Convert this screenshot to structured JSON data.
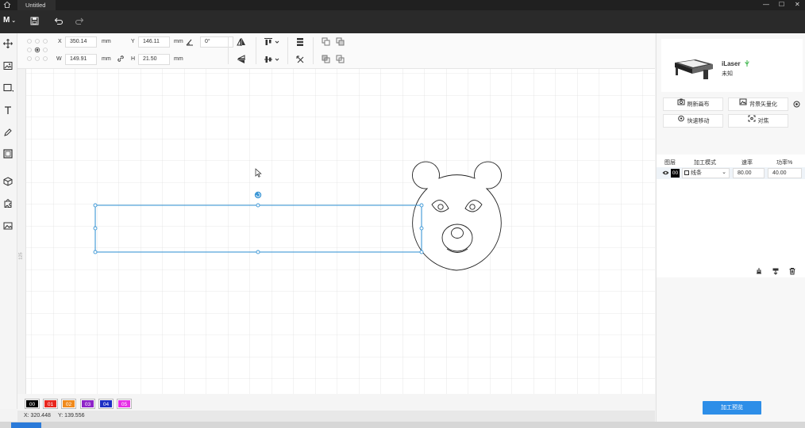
{
  "window": {
    "title": "Untitled",
    "controls": [
      "—",
      "☐",
      "✕"
    ]
  },
  "toolbar": {
    "logo": "M",
    "icons": [
      "save-icon",
      "undo-icon",
      "redo-icon"
    ]
  },
  "tools": [
    "move-icon",
    "image-icon",
    "rectangle-icon",
    "text-icon",
    "pen-icon",
    "frame-icon",
    "cube-icon",
    "puzzle-icon",
    "picture-icon"
  ],
  "props": {
    "x_label": "X",
    "x_value": "350.14",
    "x_unit": "mm",
    "y_label": "Y",
    "y_value": "146.11",
    "y_unit": "mm",
    "angle_value": "0°",
    "w_label": "W",
    "w_value": "149.91",
    "w_unit": "mm",
    "h_label": "H",
    "h_value": "21.50",
    "h_unit": "mm"
  },
  "ruler": {
    "mark": "125"
  },
  "layers": {
    "chips": [
      {
        "label": "00",
        "color": "#000000"
      },
      {
        "label": "01",
        "color": "#e8261e"
      },
      {
        "label": "02",
        "color": "#f08a1c"
      },
      {
        "label": "03",
        "color": "#8e24c8"
      },
      {
        "label": "04",
        "color": "#1c2fc4"
      },
      {
        "label": "05",
        "color": "#e62ee6"
      }
    ]
  },
  "status": {
    "x": "X: 320.448",
    "y": "Y: 139.556"
  },
  "device": {
    "name": "iLaser",
    "status": "未知"
  },
  "actions": {
    "refresh_canvas": "刷新画布",
    "vectorize_bg": "背景矢量化",
    "quick_move": "快速移动",
    "focus": "对焦"
  },
  "layer_table": {
    "headers": [
      "图层",
      "加工模式",
      "速率",
      "功率%"
    ],
    "row": {
      "layer_id": "00",
      "mode": "线条",
      "speed": "80.00",
      "power": "40.00"
    }
  },
  "process_button": "加工预览"
}
